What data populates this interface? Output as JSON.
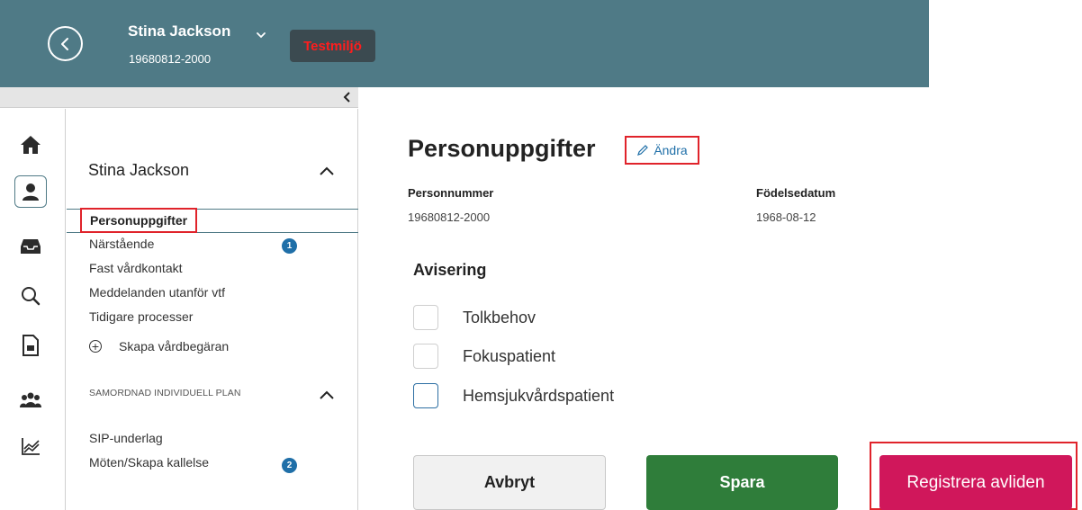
{
  "header": {
    "patient_name": "Stina Jackson",
    "patient_id": "19680812-2000",
    "environment_badge": "Testmiljö",
    "background_color": "#4f7a86"
  },
  "collapse_bar": {
    "icon": "chevron-left-icon"
  },
  "icon_rail": [
    {
      "name": "home-icon",
      "active": false
    },
    {
      "name": "patient-icon",
      "active": true
    },
    {
      "name": "inbox-icon",
      "active": false
    },
    {
      "name": "search-icon",
      "active": false
    },
    {
      "name": "document-chart-icon",
      "active": false
    },
    {
      "name": "group-icon",
      "active": false
    },
    {
      "name": "trend-chart-icon",
      "active": false
    }
  ],
  "sidebar": {
    "title": "Stina Jackson",
    "active_item": "Personuppgifter",
    "items": [
      {
        "label": "Närstående",
        "badge": "1"
      },
      {
        "label": "Fast vårdkontakt"
      },
      {
        "label": "Meddelanden utanför vtf"
      },
      {
        "label": "Tidigare processer"
      }
    ],
    "create_action": "Skapa vårdbegäran",
    "section_title": "SAMORDNAD INDIVIDUELL PLAN",
    "section_items": [
      {
        "label": "SIP-underlag"
      },
      {
        "label": "Möten/Skapa kallelse",
        "badge": "2"
      }
    ]
  },
  "main": {
    "title": "Personuppgifter",
    "edit_label": "Ändra",
    "fields": [
      {
        "label": "Personnummer",
        "value": "19680812-2000"
      },
      {
        "label": "Födelsedatum",
        "value": "1968-08-12"
      }
    ],
    "avisering_heading": "Avisering",
    "checkboxes": [
      {
        "label": "Tolkbehov",
        "checked": false
      },
      {
        "label": "Fokuspatient",
        "checked": false
      },
      {
        "label": "Hemsjukvårdspatient",
        "checked": false
      }
    ],
    "buttons": {
      "cancel": "Avbryt",
      "save": "Spara",
      "register_deceased": "Registrera avliden"
    }
  },
  "colors": {
    "accent_blue": "#1f6fa8",
    "save_green": "#2f7d3a",
    "deceased_pink": "#d0175b",
    "highlight_red": "#e0232b"
  }
}
